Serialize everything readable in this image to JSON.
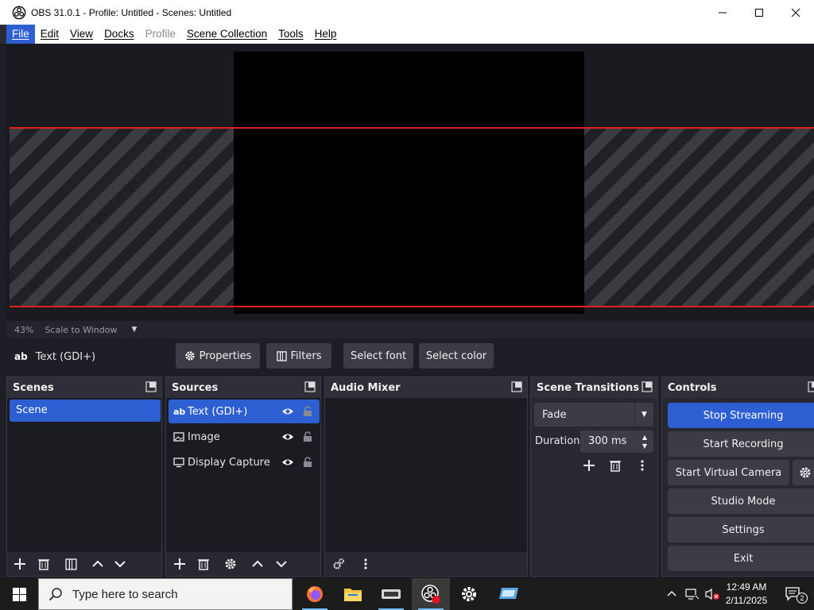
{
  "window": {
    "title": "OBS 31.0.1 - Profile: Untitled - Scenes: Untitled",
    "minimize": "—",
    "maximize": "☐",
    "close": "✕"
  },
  "menu": {
    "items": [
      {
        "label": "File",
        "state": "active"
      },
      {
        "label": "Edit",
        "state": "normal"
      },
      {
        "label": "View",
        "state": "normal"
      },
      {
        "label": "Docks",
        "state": "normal"
      },
      {
        "label": "Profile",
        "state": "disabled"
      },
      {
        "label": "Scene Collection",
        "state": "normal"
      },
      {
        "label": "Tools",
        "state": "normal"
      },
      {
        "label": "Help",
        "state": "normal"
      }
    ]
  },
  "preview": {
    "zoom": "43%",
    "zoom_mode": "Scale to Window"
  },
  "context_bar": {
    "source_icon": "ab",
    "source_name": "Text (GDI+)",
    "properties": "Properties",
    "filters": "Filters",
    "select_font": "Select font",
    "select_color": "Select color"
  },
  "scenes": {
    "title": "Scenes",
    "items": [
      "Scene"
    ]
  },
  "sources": {
    "title": "Sources",
    "items": [
      {
        "icon": "ab",
        "name": "Text (GDI+)"
      },
      {
        "icon": "image-icon",
        "name": "Image"
      },
      {
        "icon": "monitor-icon",
        "name": "Display Capture"
      }
    ]
  },
  "audio_mixer": {
    "title": "Audio Mixer"
  },
  "scene_transitions": {
    "title": "Scene Transitions",
    "transition": "Fade",
    "duration_label": "Duration",
    "duration_value": "300 ms"
  },
  "controls": {
    "title": "Controls",
    "stop_streaming": "Stop Streaming",
    "start_recording": "Start Recording",
    "start_virtual_camera": "Start Virtual Camera",
    "studio_mode": "Studio Mode",
    "settings": "Settings",
    "exit": "Exit"
  },
  "taskbar": {
    "search_placeholder": "Type here to search",
    "time": "12:49 AM",
    "date": "2/11/2025",
    "notification_count": "2"
  },
  "colors": {
    "accent": "#2d5fd3",
    "panel": "#272831",
    "bounds": "#e02020"
  }
}
